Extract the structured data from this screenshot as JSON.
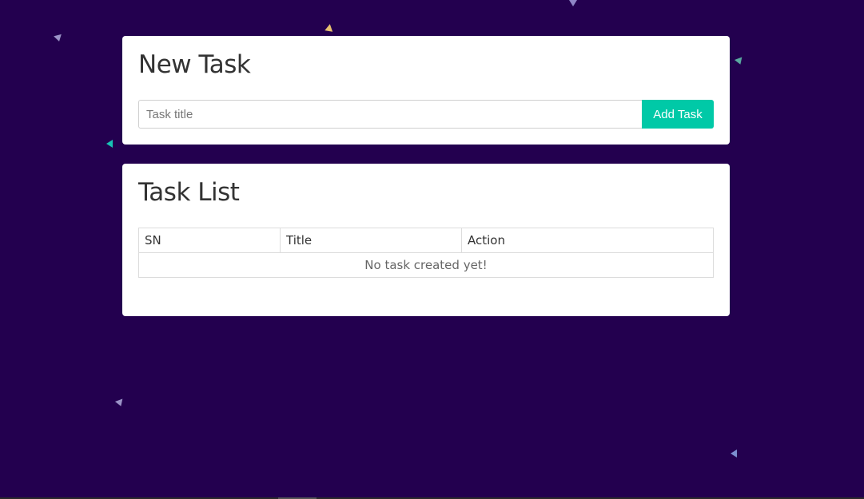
{
  "colors": {
    "background": "#23004f",
    "accent": "#00c9a7",
    "card": "#ffffff"
  },
  "new_task": {
    "title": "New Task",
    "input_placeholder": "Task title",
    "input_value": "",
    "add_button_label": "Add Task"
  },
  "task_list": {
    "title": "Task List",
    "columns": [
      "SN",
      "Title",
      "Action"
    ],
    "empty_message": "No task created yet!"
  }
}
